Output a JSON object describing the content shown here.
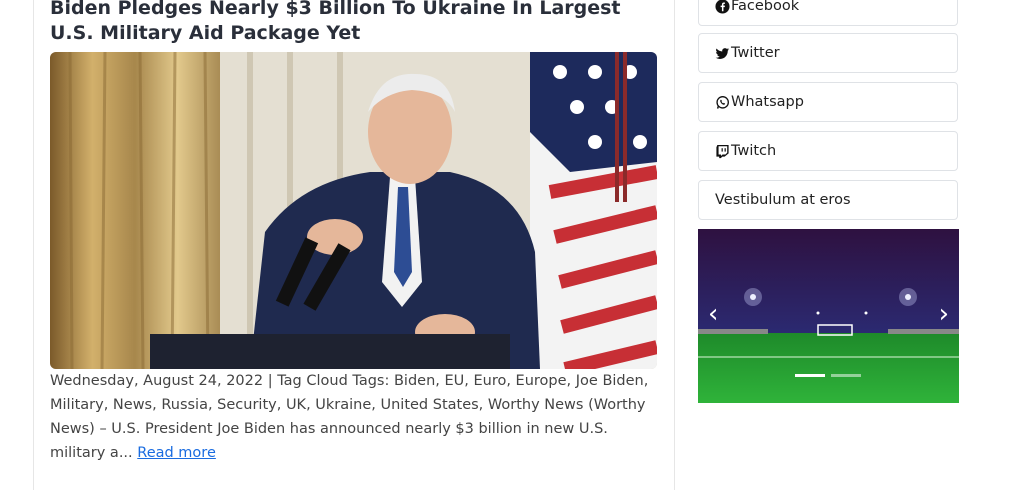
{
  "article": {
    "title": "Biden Pledges Nearly $3 Billion To Ukraine In Largest U.S. Military Aid Package Yet",
    "excerpt": "Wednesday, August 24, 2022 | Tag Cloud Tags: Biden, EU, Euro, Europe, Joe Biden, Military, News, Russia, Security, UK, Ukraine, United States, Worthy News (Worthy News) – U.S. President Joe Biden has announced nearly $3 billion in new U.S. military a...",
    "read_more": "Read more"
  },
  "sidebar": {
    "links": [
      {
        "label": "Facebook",
        "icon": "facebook-icon"
      },
      {
        "label": "Twitter",
        "icon": "twitter-icon"
      },
      {
        "label": "Whatsapp",
        "icon": "whatsapp-icon"
      },
      {
        "label": "Twitch",
        "icon": "twitch-icon"
      },
      {
        "label": "Vestibulum at eros",
        "icon": ""
      }
    ],
    "carousel": {
      "slides": 2,
      "active": 1
    }
  }
}
